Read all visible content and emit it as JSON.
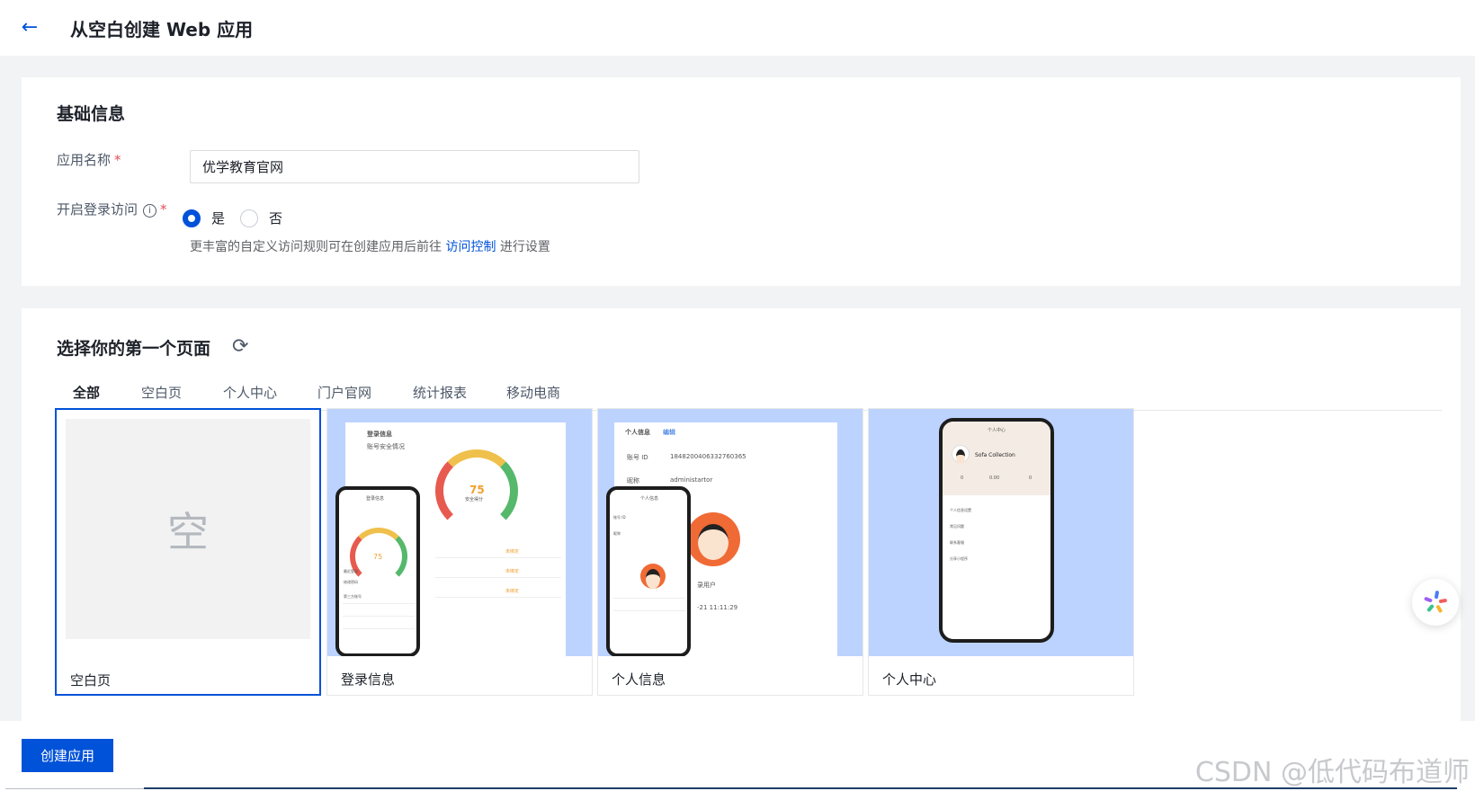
{
  "header": {
    "back_icon": "arrow-left-icon",
    "title": "从空白创建 Web 应用"
  },
  "basic": {
    "title": "基础信息",
    "app_name_label": "应用名称",
    "app_name_value": "优学教育官网",
    "login_label": "开启登录访问",
    "required_mark": "*",
    "radio_yes": "是",
    "radio_no": "否",
    "radio_selected": "是",
    "hint_prefix": "更丰富的自定义访问规则可在创建应用后前往",
    "hint_link": "访问控制",
    "hint_suffix": "进行设置"
  },
  "pages": {
    "title": "选择你的第一个页面",
    "tabs": [
      {
        "label": "全部",
        "active": true
      },
      {
        "label": "空白页"
      },
      {
        "label": "个人中心"
      },
      {
        "label": "门户官网"
      },
      {
        "label": "统计报表"
      },
      {
        "label": "移动电商"
      }
    ],
    "templates": [
      {
        "name": "空白页",
        "thumb_text": "空",
        "selected": true
      },
      {
        "name": "登录信息"
      },
      {
        "name": "个人信息"
      },
      {
        "name": "个人中心"
      }
    ],
    "thumbs": {
      "login": {
        "title": "登录信息",
        "sub": "账号安全情况",
        "gauge_value": "75",
        "gauge_label": "安全得分",
        "gauge_min": "0",
        "gauge_max": "100",
        "rows": [
          "最近登录",
          "修改密码",
          "第三方账号"
        ],
        "right": [
          "未绑定",
          "未绑定",
          "未绑定"
        ]
      },
      "profile": {
        "title": "个人信息",
        "edit": "编辑",
        "id_label": "账号 ID",
        "id_value": "1848200406332760365",
        "nick_label": "昵称",
        "nick_value": "administartor",
        "role": "录用户",
        "time": "-21 11:11:29"
      },
      "center": {
        "title": "个人中心",
        "name": "Sofa Collection",
        "stats": [
          "0",
          "0.00",
          "0"
        ],
        "items": [
          "个人信息设置",
          "常见问题",
          "联系客服",
          "分享小程序"
        ]
      }
    }
  },
  "actions": {
    "create_label": "创建应用"
  },
  "watermark": "CSDN @低代码布道师",
  "colors": {
    "primary": "#0052d9",
    "required": "#e34d59",
    "thumb_bg": "#bcd3ff"
  }
}
